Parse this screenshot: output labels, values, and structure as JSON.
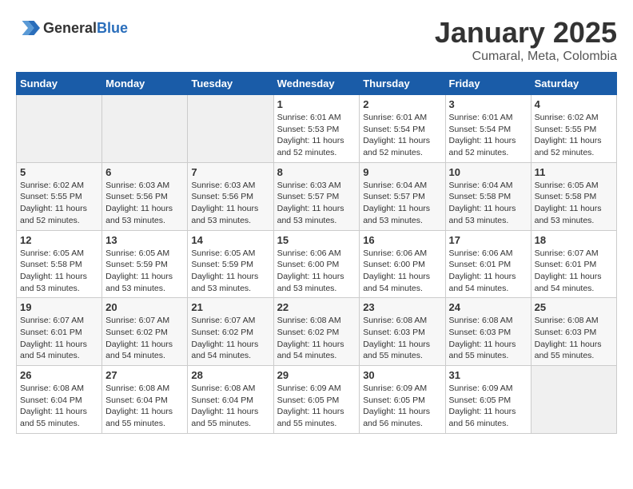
{
  "header": {
    "logo_general": "General",
    "logo_blue": "Blue",
    "month": "January 2025",
    "location": "Cumaral, Meta, Colombia"
  },
  "weekdays": [
    "Sunday",
    "Monday",
    "Tuesday",
    "Wednesday",
    "Thursday",
    "Friday",
    "Saturday"
  ],
  "weeks": [
    [
      {
        "day": "",
        "info": ""
      },
      {
        "day": "",
        "info": ""
      },
      {
        "day": "",
        "info": ""
      },
      {
        "day": "1",
        "info": "Sunrise: 6:01 AM\nSunset: 5:53 PM\nDaylight: 11 hours\nand 52 minutes."
      },
      {
        "day": "2",
        "info": "Sunrise: 6:01 AM\nSunset: 5:54 PM\nDaylight: 11 hours\nand 52 minutes."
      },
      {
        "day": "3",
        "info": "Sunrise: 6:01 AM\nSunset: 5:54 PM\nDaylight: 11 hours\nand 52 minutes."
      },
      {
        "day": "4",
        "info": "Sunrise: 6:02 AM\nSunset: 5:55 PM\nDaylight: 11 hours\nand 52 minutes."
      }
    ],
    [
      {
        "day": "5",
        "info": "Sunrise: 6:02 AM\nSunset: 5:55 PM\nDaylight: 11 hours\nand 52 minutes."
      },
      {
        "day": "6",
        "info": "Sunrise: 6:03 AM\nSunset: 5:56 PM\nDaylight: 11 hours\nand 53 minutes."
      },
      {
        "day": "7",
        "info": "Sunrise: 6:03 AM\nSunset: 5:56 PM\nDaylight: 11 hours\nand 53 minutes."
      },
      {
        "day": "8",
        "info": "Sunrise: 6:03 AM\nSunset: 5:57 PM\nDaylight: 11 hours\nand 53 minutes."
      },
      {
        "day": "9",
        "info": "Sunrise: 6:04 AM\nSunset: 5:57 PM\nDaylight: 11 hours\nand 53 minutes."
      },
      {
        "day": "10",
        "info": "Sunrise: 6:04 AM\nSunset: 5:58 PM\nDaylight: 11 hours\nand 53 minutes."
      },
      {
        "day": "11",
        "info": "Sunrise: 6:05 AM\nSunset: 5:58 PM\nDaylight: 11 hours\nand 53 minutes."
      }
    ],
    [
      {
        "day": "12",
        "info": "Sunrise: 6:05 AM\nSunset: 5:58 PM\nDaylight: 11 hours\nand 53 minutes."
      },
      {
        "day": "13",
        "info": "Sunrise: 6:05 AM\nSunset: 5:59 PM\nDaylight: 11 hours\nand 53 minutes."
      },
      {
        "day": "14",
        "info": "Sunrise: 6:05 AM\nSunset: 5:59 PM\nDaylight: 11 hours\nand 53 minutes."
      },
      {
        "day": "15",
        "info": "Sunrise: 6:06 AM\nSunset: 6:00 PM\nDaylight: 11 hours\nand 53 minutes."
      },
      {
        "day": "16",
        "info": "Sunrise: 6:06 AM\nSunset: 6:00 PM\nDaylight: 11 hours\nand 54 minutes."
      },
      {
        "day": "17",
        "info": "Sunrise: 6:06 AM\nSunset: 6:01 PM\nDaylight: 11 hours\nand 54 minutes."
      },
      {
        "day": "18",
        "info": "Sunrise: 6:07 AM\nSunset: 6:01 PM\nDaylight: 11 hours\nand 54 minutes."
      }
    ],
    [
      {
        "day": "19",
        "info": "Sunrise: 6:07 AM\nSunset: 6:01 PM\nDaylight: 11 hours\nand 54 minutes."
      },
      {
        "day": "20",
        "info": "Sunrise: 6:07 AM\nSunset: 6:02 PM\nDaylight: 11 hours\nand 54 minutes."
      },
      {
        "day": "21",
        "info": "Sunrise: 6:07 AM\nSunset: 6:02 PM\nDaylight: 11 hours\nand 54 minutes."
      },
      {
        "day": "22",
        "info": "Sunrise: 6:08 AM\nSunset: 6:02 PM\nDaylight: 11 hours\nand 54 minutes."
      },
      {
        "day": "23",
        "info": "Sunrise: 6:08 AM\nSunset: 6:03 PM\nDaylight: 11 hours\nand 55 minutes."
      },
      {
        "day": "24",
        "info": "Sunrise: 6:08 AM\nSunset: 6:03 PM\nDaylight: 11 hours\nand 55 minutes."
      },
      {
        "day": "25",
        "info": "Sunrise: 6:08 AM\nSunset: 6:03 PM\nDaylight: 11 hours\nand 55 minutes."
      }
    ],
    [
      {
        "day": "26",
        "info": "Sunrise: 6:08 AM\nSunset: 6:04 PM\nDaylight: 11 hours\nand 55 minutes."
      },
      {
        "day": "27",
        "info": "Sunrise: 6:08 AM\nSunset: 6:04 PM\nDaylight: 11 hours\nand 55 minutes."
      },
      {
        "day": "28",
        "info": "Sunrise: 6:08 AM\nSunset: 6:04 PM\nDaylight: 11 hours\nand 55 minutes."
      },
      {
        "day": "29",
        "info": "Sunrise: 6:09 AM\nSunset: 6:05 PM\nDaylight: 11 hours\nand 55 minutes."
      },
      {
        "day": "30",
        "info": "Sunrise: 6:09 AM\nSunset: 6:05 PM\nDaylight: 11 hours\nand 56 minutes."
      },
      {
        "day": "31",
        "info": "Sunrise: 6:09 AM\nSunset: 6:05 PM\nDaylight: 11 hours\nand 56 minutes."
      },
      {
        "day": "",
        "info": ""
      }
    ]
  ]
}
